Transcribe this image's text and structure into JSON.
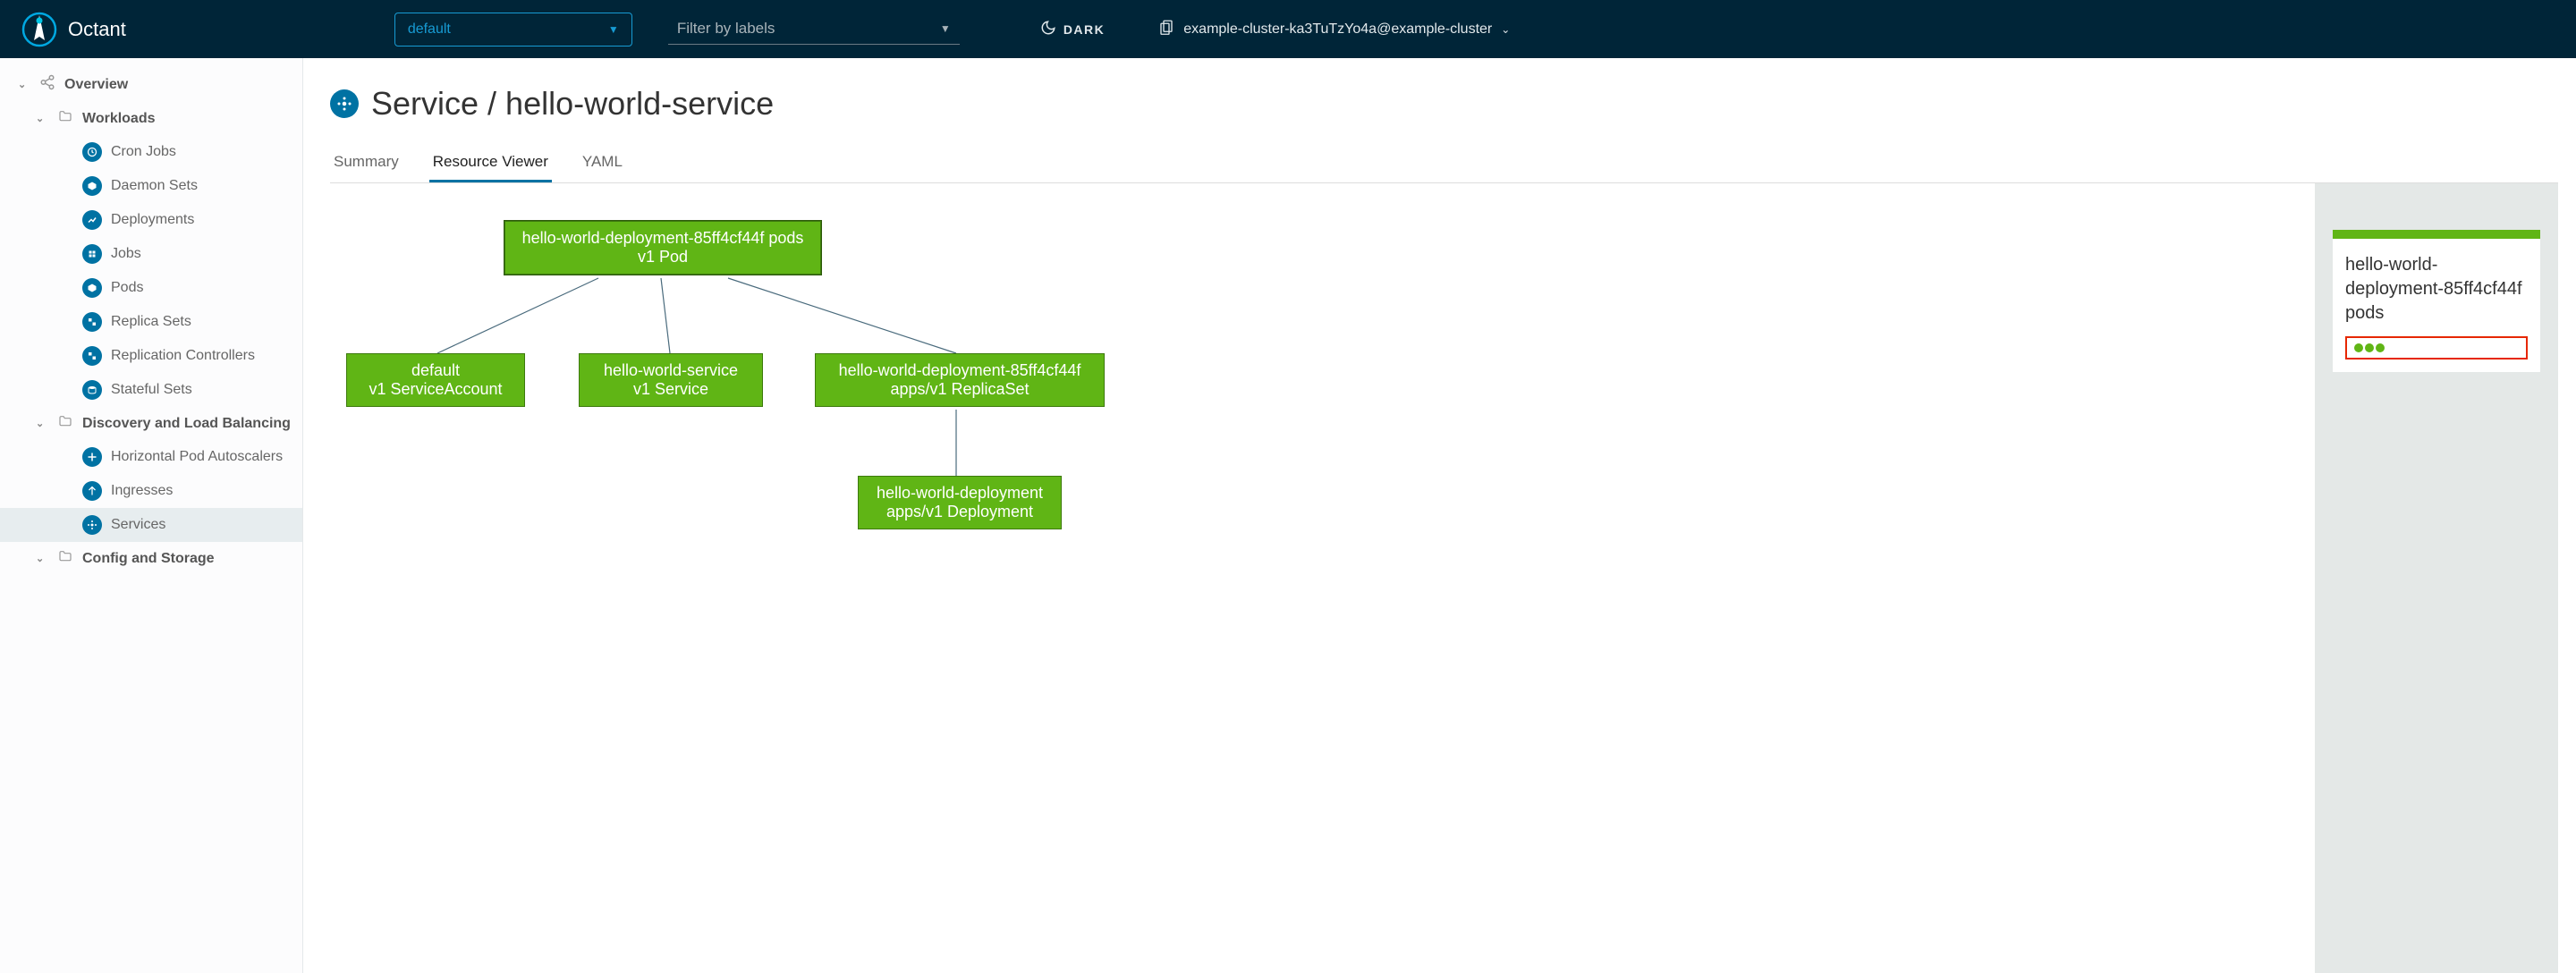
{
  "app": {
    "name": "Octant"
  },
  "topbar": {
    "namespace": "default",
    "filter_placeholder": "Filter by labels",
    "theme_label": "DARK",
    "cluster": "example-cluster-ka3TuTzYo4a@example-cluster"
  },
  "sidebar": {
    "overview": "Overview",
    "workloads": {
      "label": "Workloads",
      "items": [
        "Cron Jobs",
        "Daemon Sets",
        "Deployments",
        "Jobs",
        "Pods",
        "Replica Sets",
        "Replication Controllers",
        "Stateful Sets"
      ]
    },
    "discovery": {
      "label": "Discovery and Load Balancing",
      "items": [
        "Horizontal Pod Autoscalers",
        "Ingresses",
        "Services"
      ]
    },
    "config": {
      "label": "Config and Storage"
    }
  },
  "page": {
    "title": "Service / hello-world-service",
    "tabs": [
      "Summary",
      "Resource Viewer",
      "YAML"
    ],
    "active_tab": 1
  },
  "graph": {
    "pods": {
      "l1": "hello-world-deployment-85ff4cf44f pods",
      "l2": "v1 Pod"
    },
    "sa": {
      "l1": "default",
      "l2": "v1 ServiceAccount"
    },
    "svc": {
      "l1": "hello-world-service",
      "l2": "v1 Service"
    },
    "rs": {
      "l1": "hello-world-deployment-85ff4cf44f",
      "l2": "apps/v1 ReplicaSet"
    },
    "dep": {
      "l1": "hello-world-deployment",
      "l2": "apps/v1 Deployment"
    }
  },
  "info": {
    "title": "hello-world-deployment-85ff4cf44f pods"
  }
}
